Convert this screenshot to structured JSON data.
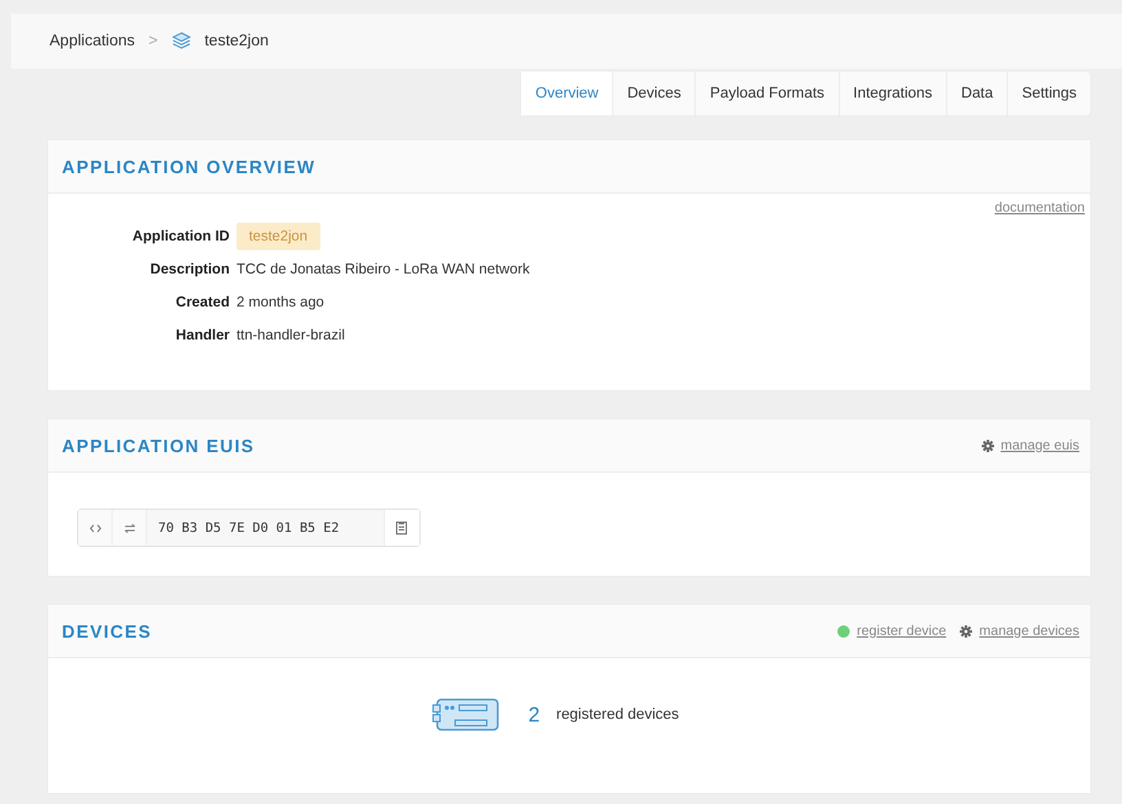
{
  "breadcrumb": {
    "root": "Applications",
    "separator": ">",
    "current": "teste2jon"
  },
  "tabs": [
    {
      "label": "Overview",
      "selected": true
    },
    {
      "label": "Devices",
      "selected": false
    },
    {
      "label": "Payload Formats",
      "selected": false
    },
    {
      "label": "Integrations",
      "selected": false
    },
    {
      "label": "Data",
      "selected": false
    },
    {
      "label": "Settings",
      "selected": false
    }
  ],
  "overview": {
    "title": "APPLICATION OVERVIEW",
    "link": "documentation",
    "fields": [
      {
        "label": "Application ID",
        "value": "teste2jon",
        "kind": "badge"
      },
      {
        "label": "Description",
        "value": "TCC de Jonatas Ribeiro - LoRa WAN network",
        "kind": "text"
      },
      {
        "label": "Created",
        "value": "2 months ago",
        "kind": "text"
      },
      {
        "label": "Handler",
        "value": "ttn-handler-brazil",
        "kind": "text"
      }
    ]
  },
  "euis": {
    "title": "APPLICATION EUIS",
    "actions": [
      {
        "label": "manage euis",
        "kind": "manage"
      }
    ],
    "items": [
      {
        "value": "70 B3 D5 7E D0 01 B5 E2"
      }
    ]
  },
  "devices": {
    "title": "DEVICES",
    "actions": [
      {
        "label": "register device",
        "kind": "add"
      },
      {
        "label": "manage devices",
        "kind": "manage"
      }
    ],
    "count": "2",
    "count_label": "registered devices"
  }
}
